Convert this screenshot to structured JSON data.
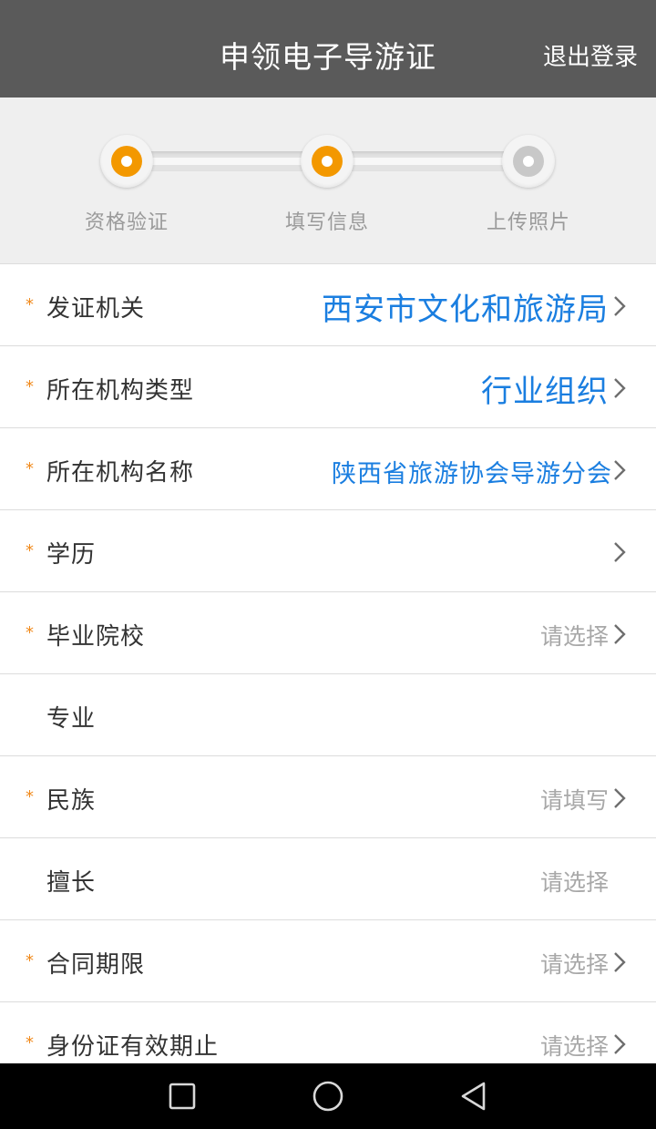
{
  "header": {
    "title": "申领电子导游证",
    "logout": "退出登录"
  },
  "steps": [
    {
      "label": "资格验证",
      "state": "done"
    },
    {
      "label": "填写信息",
      "state": "active"
    },
    {
      "label": "上传照片",
      "state": "pending"
    }
  ],
  "colors": {
    "accent": "#f08a1c",
    "link": "#1a7ee0",
    "header_bg": "#5a5a5a",
    "step_done": "#f39800",
    "step_pending": "#c8c8c8"
  },
  "form": {
    "rows": [
      {
        "label": "发证机关",
        "required": true,
        "value": "西安市文化和旅游局",
        "chevron": true
      },
      {
        "label": "所在机构类型",
        "required": true,
        "value": "行业组织",
        "chevron": true
      },
      {
        "label": "所在机构名称",
        "required": true,
        "value": "陕西省旅游协会导游分会",
        "chevron": true
      },
      {
        "label": "学历",
        "required": true,
        "value": "",
        "chevron": true
      },
      {
        "label": "毕业院校",
        "required": true,
        "placeholder": "请选择",
        "chevron": true
      },
      {
        "label": "专业",
        "required": false,
        "value": "",
        "chevron": false
      },
      {
        "label": "民族",
        "required": true,
        "placeholder": "请填写",
        "chevron": true
      },
      {
        "label": "擅长",
        "required": false,
        "placeholder": "请选择",
        "chevron": false
      },
      {
        "label": "合同期限",
        "required": true,
        "placeholder": "请选择",
        "chevron": true
      },
      {
        "label": "身份证有效期止",
        "required": true,
        "placeholder": "请选择",
        "chevron": true
      }
    ]
  },
  "nav": {
    "icons": [
      "square-icon",
      "circle-icon",
      "triangle-back-icon"
    ]
  }
}
